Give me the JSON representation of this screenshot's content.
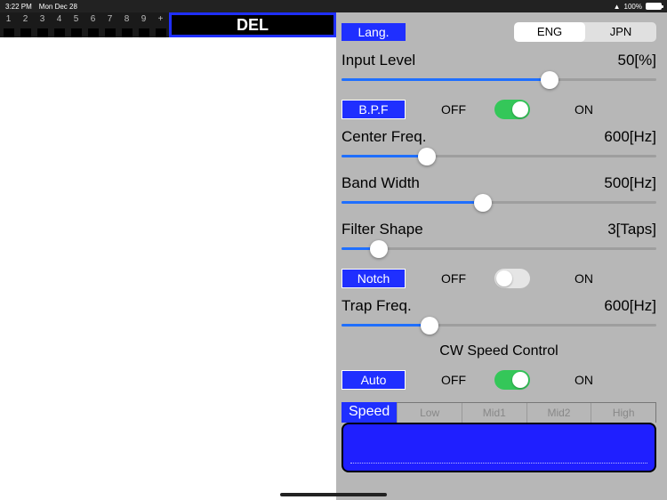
{
  "status": {
    "time": "3:22 PM",
    "date": "Mon Dec 28",
    "wifi": "wifi-icon",
    "battery_pct": "100%"
  },
  "numbers": [
    "1",
    "2",
    "3",
    "4",
    "5",
    "6",
    "7",
    "8",
    "9",
    "+"
  ],
  "del_label": "DEL",
  "lang": {
    "badge": "Lang.",
    "opt1": "ENG",
    "opt2": "JPN",
    "active": 0
  },
  "input_level": {
    "label": "Input Level",
    "value": "50[%]",
    "pct": 66
  },
  "bpf": {
    "badge": "B.P.F",
    "off": "OFF",
    "on": "ON",
    "state": true
  },
  "center_freq": {
    "label": "Center Freq.",
    "value": "600[Hz]",
    "pct": 27
  },
  "band_width": {
    "label": "Band Width",
    "value": "500[Hz]",
    "pct": 45
  },
  "filter_shape": {
    "label": "Filter Shape",
    "value": "3[Taps]",
    "pct": 12
  },
  "notch": {
    "badge": "Notch",
    "off": "OFF",
    "on": "ON",
    "state": false
  },
  "trap_freq": {
    "label": "Trap Freq.",
    "value": "600[Hz]",
    "pct": 28
  },
  "cw_title": "CW Speed Control",
  "auto": {
    "badge": "Auto",
    "off": "OFF",
    "on": "ON",
    "state": true
  },
  "speed": {
    "label": "Speed",
    "tabs": [
      "Low",
      "Mid1",
      "Mid2",
      "High"
    ]
  }
}
